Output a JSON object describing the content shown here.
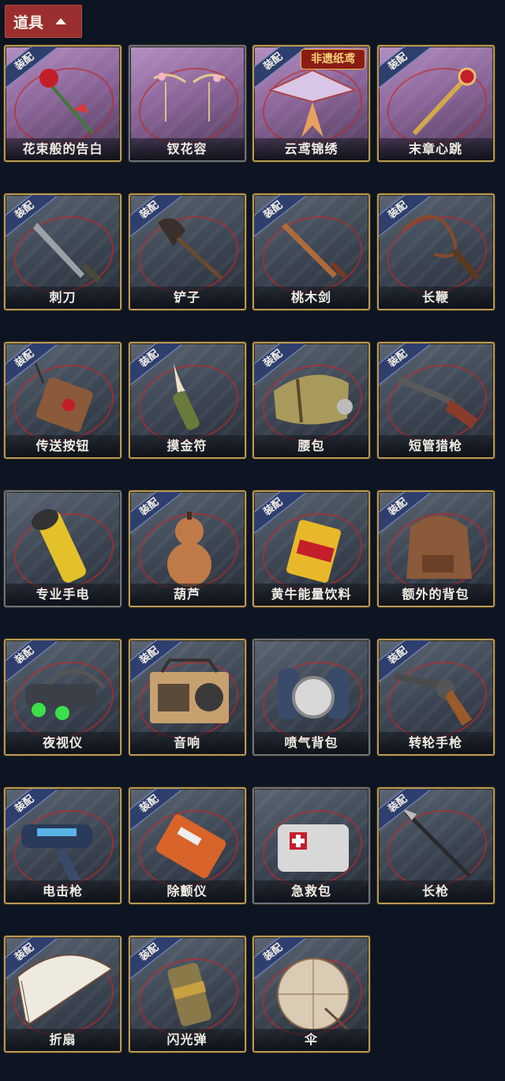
{
  "header": {
    "title": "道具"
  },
  "equip_label": "装配",
  "heritage_badge": "非遗纸鸢",
  "items": [
    {
      "name": "花束般的告白",
      "equipped": true,
      "bg": "purple",
      "icon": "rose-bouquet-icon"
    },
    {
      "name": "钗花容",
      "equipped": false,
      "bg": "purple",
      "icon": "hairpins-icon"
    },
    {
      "name": "云鸢锦绣",
      "equipped": true,
      "bg": "purple",
      "icon": "kite-icon",
      "heritage": true
    },
    {
      "name": "末章心跳",
      "equipped": true,
      "bg": "purple",
      "icon": "scepter-icon"
    },
    {
      "name": "刺刀",
      "equipped": true,
      "bg": "gray",
      "icon": "bayonet-icon"
    },
    {
      "name": "铲子",
      "equipped": true,
      "bg": "gray",
      "icon": "shovel-icon"
    },
    {
      "name": "桃木剑",
      "equipped": true,
      "bg": "gray",
      "icon": "wooden-sword-icon"
    },
    {
      "name": "长鞭",
      "equipped": true,
      "bg": "gray",
      "icon": "whip-icon"
    },
    {
      "name": "传送按钮",
      "equipped": true,
      "bg": "gray",
      "icon": "remote-button-icon"
    },
    {
      "name": "摸金符",
      "equipped": true,
      "bg": "gray",
      "icon": "talisman-tooth-icon"
    },
    {
      "name": "腰包",
      "equipped": true,
      "bg": "gray",
      "icon": "waist-bag-icon"
    },
    {
      "name": "短管猎枪",
      "equipped": true,
      "bg": "gray",
      "icon": "shotgun-icon"
    },
    {
      "name": "专业手电",
      "equipped": false,
      "bg": "gray",
      "icon": "flashlight-icon"
    },
    {
      "name": "葫芦",
      "equipped": true,
      "bg": "gray",
      "icon": "gourd-icon"
    },
    {
      "name": "黄牛能量饮料",
      "equipped": true,
      "bg": "gray",
      "icon": "energy-drink-icon"
    },
    {
      "name": "额外的背包",
      "equipped": true,
      "bg": "gray",
      "icon": "backpack-icon"
    },
    {
      "name": "夜视仪",
      "equipped": true,
      "bg": "gray",
      "icon": "night-goggles-icon"
    },
    {
      "name": "音响",
      "equipped": true,
      "bg": "gray",
      "icon": "radio-icon"
    },
    {
      "name": "喷气背包",
      "equipped": false,
      "bg": "gray",
      "icon": "jetpack-icon"
    },
    {
      "name": "转轮手枪",
      "equipped": true,
      "bg": "gray",
      "icon": "revolver-icon"
    },
    {
      "name": "电击枪",
      "equipped": true,
      "bg": "gray",
      "icon": "shock-gun-icon"
    },
    {
      "name": "除颤仪",
      "equipped": true,
      "bg": "gray",
      "icon": "defibrillator-icon"
    },
    {
      "name": "急救包",
      "equipped": false,
      "bg": "gray",
      "icon": "first-aid-icon"
    },
    {
      "name": "长枪",
      "equipped": true,
      "bg": "gray",
      "icon": "spear-icon"
    },
    {
      "name": "折扇",
      "equipped": true,
      "bg": "gray",
      "icon": "folding-fan-icon"
    },
    {
      "name": "闪光弹",
      "equipped": true,
      "bg": "gray",
      "icon": "flashbang-icon"
    },
    {
      "name": "伞",
      "equipped": true,
      "bg": "gray",
      "icon": "umbrella-icon"
    }
  ]
}
